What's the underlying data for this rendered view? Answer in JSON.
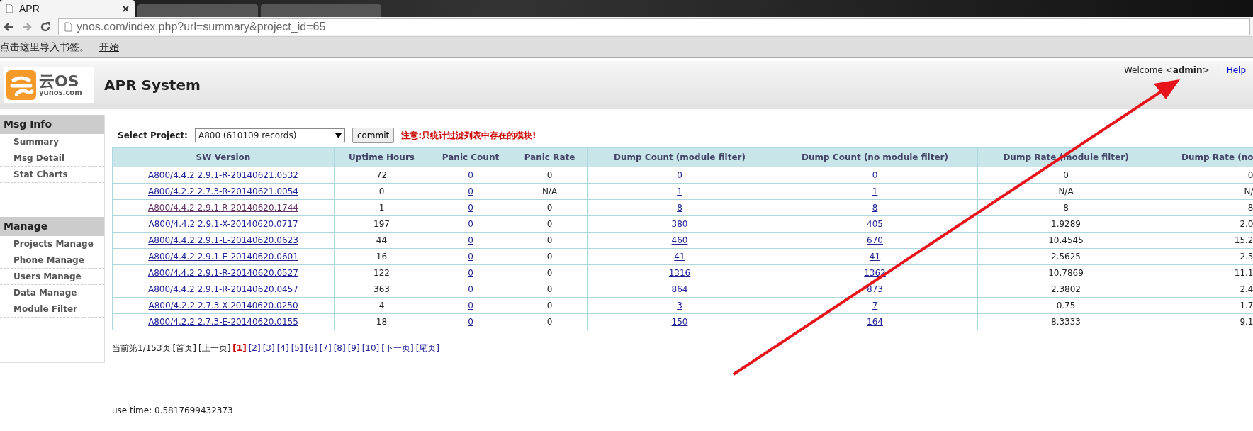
{
  "browser": {
    "tabs": [
      {
        "title": "APR",
        "selected": true
      },
      {
        "selected": false
      },
      {
        "selected": false
      }
    ],
    "url": "ynos.com/index.php?url=summary&project_id=65",
    "bookmarks_hint": "点击这里导入书签。",
    "bookmarks_link": "开始"
  },
  "header": {
    "logo_mark": "云OS",
    "logo_domain": "yunos.com",
    "title": "APR System",
    "welcome": "Welcome <**admin**>",
    "separator": "|",
    "help": "Help"
  },
  "sidebar": [
    {
      "heading": "Msg Info",
      "items": [
        "Summary",
        "Msg Detail",
        "Stat Charts"
      ]
    },
    {
      "heading": "Manage",
      "items": [
        "Projects Manage",
        "Phone Manage",
        "Users Manage",
        "Data Manage",
        "Module Filter"
      ]
    }
  ],
  "filter": {
    "label": "Select Project:",
    "value": "A800 (610109 records)",
    "button": "commit",
    "notice": "注意:只统计过滤列表中存在的模块!"
  },
  "table": {
    "columns": [
      "SW Version",
      "Uptime Hours",
      "Panic Count",
      "Panic Rate",
      "Dump Count (module filter)",
      "Dump Count (no module filter)",
      "Dump Rate (module filter)",
      "Dump Rate (no"
    ],
    "rows": [
      {
        "visited": false,
        "cells": [
          "A800/4.4.2 2.9.1-R-20140621.0532",
          "72",
          "0",
          "0",
          "0",
          "0",
          "0",
          "0"
        ]
      },
      {
        "visited": false,
        "cells": [
          "A800/4.2.2 2.7.3-R-20140621.0054",
          "0",
          "0",
          "N/A",
          "1",
          "1",
          "N/A",
          "N/"
        ]
      },
      {
        "visited": true,
        "cells": [
          "A800/4.4.2 2.9.1-R-20140620.1744",
          "1",
          "0",
          "0",
          "8",
          "8",
          "8",
          "8"
        ]
      },
      {
        "visited": false,
        "cells": [
          "A800/4.4.2 2.9.1-X-20140620.0717",
          "197",
          "0",
          "0",
          "380",
          "405",
          "1.9289",
          "2.0"
        ]
      },
      {
        "visited": false,
        "cells": [
          "A800/4.4.2 2.9.1-E-20140620.0623",
          "44",
          "0",
          "0",
          "460",
          "670",
          "10.4545",
          "15.2"
        ]
      },
      {
        "visited": false,
        "cells": [
          "A800/4.4.2 2.9.1-E-20140620.0601",
          "16",
          "0",
          "0",
          "41",
          "41",
          "2.5625",
          "2.5"
        ]
      },
      {
        "visited": false,
        "cells": [
          "A800/4.4.2 2.9.1-R-20140620.0527",
          "122",
          "0",
          "0",
          "1316",
          "1362",
          "10.7869",
          "11.1"
        ]
      },
      {
        "visited": false,
        "cells": [
          "A800/4.4.2 2.9.1-R-20140620.0457",
          "363",
          "0",
          "0",
          "864",
          "873",
          "2.3802",
          "2.4"
        ]
      },
      {
        "visited": false,
        "cells": [
          "A800/4.2.2 2.7.3-X-20140620.0250",
          "4",
          "0",
          "0",
          "3",
          "7",
          "0.75",
          "1.7"
        ]
      },
      {
        "visited": false,
        "cells": [
          "A800/4.2.2 2.7.3-E-20140620.0155",
          "18",
          "0",
          "0",
          "150",
          "164",
          "8.3333",
          "9.1"
        ]
      }
    ]
  },
  "pagination": {
    "status": "当前第1/153页",
    "items": [
      {
        "label": "[首页]",
        "link": false,
        "current": false
      },
      {
        "label": "[上一页]",
        "link": false,
        "current": false
      },
      {
        "label": "[1]",
        "link": false,
        "current": true
      },
      {
        "label": "[2]",
        "link": true,
        "current": false
      },
      {
        "label": "[3]",
        "link": true,
        "current": false
      },
      {
        "label": "[4]",
        "link": true,
        "current": false
      },
      {
        "label": "[5]",
        "link": true,
        "current": false
      },
      {
        "label": "[6]",
        "link": true,
        "current": false
      },
      {
        "label": "[7]",
        "link": true,
        "current": false
      },
      {
        "label": "[8]",
        "link": true,
        "current": false
      },
      {
        "label": "[9]",
        "link": true,
        "current": false
      },
      {
        "label": "[10]",
        "link": true,
        "current": false
      },
      {
        "label": "[下一页]",
        "link": true,
        "current": false
      },
      {
        "label": "[尾页]",
        "link": true,
        "current": false
      }
    ]
  },
  "footer": {
    "use_time": "use time: 0.5817699432373"
  }
}
